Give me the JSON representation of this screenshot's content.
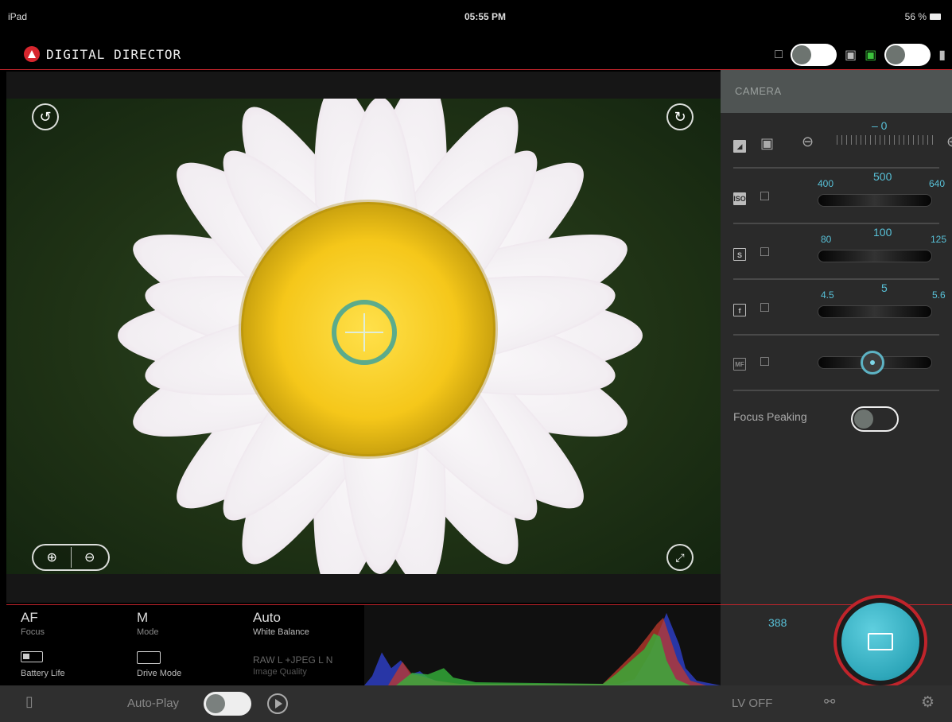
{
  "status": {
    "carrier": "iPad",
    "time": "05:55 PM",
    "battery": "56 %"
  },
  "app": {
    "title": "DIGITAL DIRECTOR"
  },
  "panel": {
    "title": "CAMERA",
    "exposure": {
      "value": "– 0"
    },
    "iso": {
      "low": "400",
      "current": "500",
      "high": "640"
    },
    "shutter": {
      "low": "80",
      "current": "100",
      "high": "125"
    },
    "aperture": {
      "low": "4.5",
      "current": "5",
      "high": "5.6"
    },
    "focus_peaking_label": "Focus Peaking"
  },
  "info": {
    "focus": {
      "value": "AF",
      "label": "Focus"
    },
    "mode": {
      "value": "M",
      "label": "Mode"
    },
    "white_balance": {
      "value": "Auto",
      "label": "White Balance"
    },
    "battery_label": "Battery Life",
    "drive_mode_label": "Drive Mode",
    "image_quality": {
      "value": "RAW L +JPEG L N",
      "label": "Image Quality"
    }
  },
  "shots_remaining": "388",
  "bottom": {
    "auto_play_label": "Auto-Play",
    "lv_label": "LV OFF"
  },
  "colors": {
    "accent_red": "#c0242b",
    "accent_cyan": "#58c1d8",
    "camera_green": "#3cc23c"
  }
}
